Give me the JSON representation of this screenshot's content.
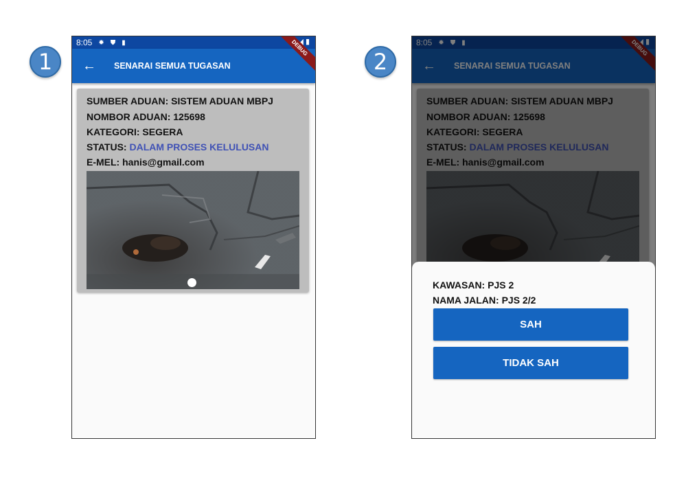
{
  "steps": [
    "1",
    "2"
  ],
  "statusbar": {
    "time": "8:05",
    "icons": [
      "gear-icon",
      "shield-icon",
      "sd-card-icon",
      "wifi-icon",
      "signal-icon",
      "battery-icon"
    ]
  },
  "debug_banner": "DEBUG",
  "appbar": {
    "back_icon": "arrow-back-icon",
    "title": "SENARAI SEMUA TUGASAN"
  },
  "card": {
    "sumber": "SUMBER ADUAN: SISTEM ADUAN MBPJ",
    "nombor": "NOMBOR ADUAN: 125698",
    "kategori": "KATEGORI: SEGERA",
    "status_label": "STATUS: ",
    "status_value": "DALAM PROSES KELULUSAN",
    "email": "E-MEL: hanis@gmail.com",
    "image": "pothole-photo"
  },
  "sheet": {
    "kawasan": "KAWASAN: PJS 2",
    "nama_jalan": "NAMA JALAN: PJS 2/2",
    "sah_label": "SAH",
    "tidak_sah_label": "TIDAK SAH"
  },
  "colors": {
    "appbar": "#1565c0",
    "statusbar": "#0d47a1",
    "status_value": "#3f51b5",
    "card_bg": "#bdbdbd",
    "button": "#1565c0"
  }
}
